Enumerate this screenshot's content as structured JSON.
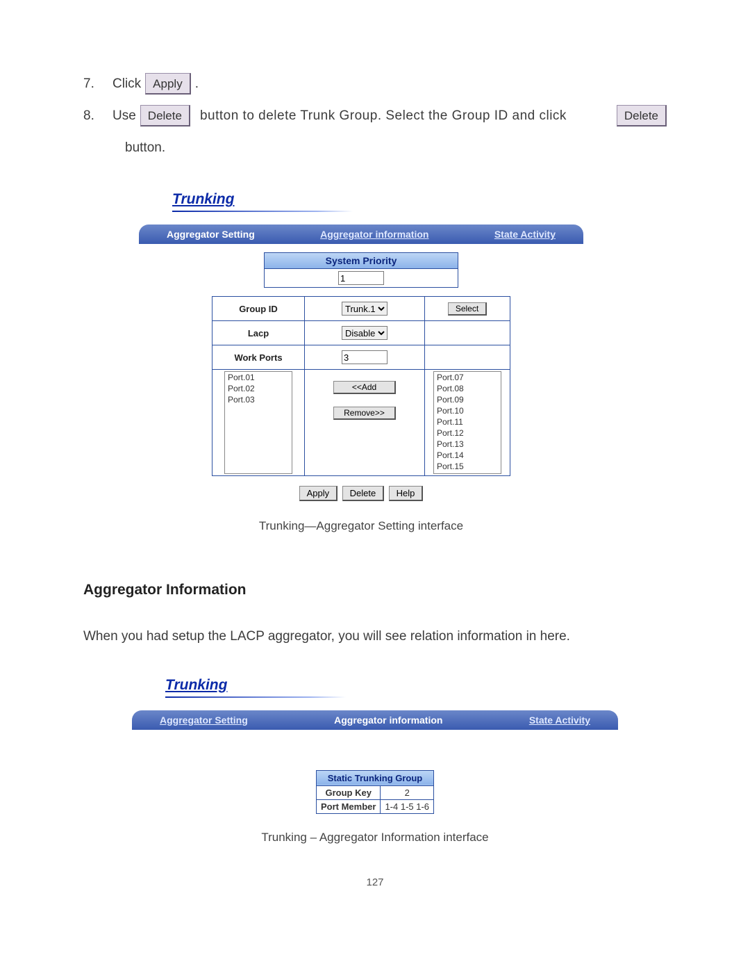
{
  "steps": {
    "s7_num": "7.",
    "s7_a": "Click",
    "s7_btn": "Apply",
    "s7_b": ".",
    "s8_num": "8.",
    "s8_a": "Use",
    "s8_btn1": "Delete",
    "s8_b": "button  to  delete  Trunk  Group.  Select  the  Group  ID  and  click",
    "s8_btn2": "Delete",
    "s8_cont": "button."
  },
  "ss1": {
    "title": "Trunking",
    "tabs": {
      "t1": "Aggregator Setting",
      "t2": "Aggregator information",
      "t3": "State Activity"
    },
    "sys_priority_hd": "System Priority",
    "sys_priority_val": "1",
    "rows": {
      "group_id_label": "Group ID",
      "group_id_val": "Trunk.1",
      "select_btn": "Select",
      "lacp_label": "Lacp",
      "lacp_val": "Disable",
      "workports_label": "Work Ports",
      "workports_val": "3"
    },
    "left_ports": [
      "Port.01",
      "Port.02",
      "Port.03"
    ],
    "right_ports": [
      "Port.07",
      "Port.08",
      "Port.09",
      "Port.10",
      "Port.11",
      "Port.12",
      "Port.13",
      "Port.14",
      "Port.15"
    ],
    "add_btn": "<<Add",
    "remove_btn": "Remove>>",
    "bottom_btns": {
      "apply": "Apply",
      "delete": "Delete",
      "help": "Help"
    },
    "caption": "Trunking—Aggregator Setting interface"
  },
  "section_h": "Aggregator Information",
  "para": "When you had setup the LACP aggregator, you will see relation information in here.",
  "ss2": {
    "title": "Trunking",
    "tabs": {
      "t1": "Aggregator Setting",
      "t2": "Aggregator information",
      "t3": "State Activity"
    },
    "table_hd": "Static Trunking Group",
    "k1": "Group Key",
    "v1": "2",
    "k2": "Port Member",
    "v2": "1-4 1-5 1-6",
    "caption": "Trunking – Aggregator Information interface"
  },
  "page_num": "127"
}
